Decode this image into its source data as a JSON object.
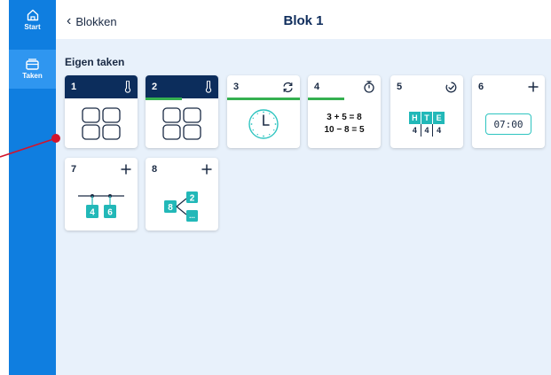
{
  "sidebar": {
    "items": [
      {
        "label": "Start",
        "icon": "home-icon"
      },
      {
        "label": "Taken",
        "icon": "tasks-icon"
      }
    ]
  },
  "header": {
    "back_label": "Blokken",
    "title": "Blok 1"
  },
  "main": {
    "section_title": "Eigen taken",
    "cards": [
      {
        "number": "1",
        "icon": "thermometer-icon",
        "content": "grid-four-squares"
      },
      {
        "number": "2",
        "icon": "thermometer-icon",
        "content": "grid-four-squares",
        "progress": 0.5
      },
      {
        "number": "3",
        "icon": "refresh-icon",
        "content": "analog-clock",
        "progress": 1.0
      },
      {
        "number": "4",
        "icon": "stopwatch-icon",
        "content": "sums",
        "sum1": "3 + 5 = 8",
        "sum2": "10 − 8 = 5",
        "progress": 0.5
      },
      {
        "number": "5",
        "icon": "check-timer-icon",
        "content": "hte-table",
        "headers": [
          "H",
          "T",
          "E"
        ],
        "values": [
          "4",
          "4",
          "4"
        ]
      },
      {
        "number": "6",
        "icon": "plus-icon",
        "content": "digital-clock",
        "time": "07:00"
      },
      {
        "number": "7",
        "icon": "plus-icon",
        "content": "number-line",
        "values": [
          "4",
          "6"
        ]
      },
      {
        "number": "8",
        "icon": "plus-icon",
        "content": "split-diagram",
        "root": "8",
        "top": "2",
        "bottom": "..."
      }
    ]
  },
  "colors": {
    "sidebar": "#0f7ee0",
    "card_header_dark": "#0c2d5c",
    "progress": "#35b050",
    "teal": "#22b8b8",
    "background": "#e8f1fb",
    "annotation": "#d2142c"
  }
}
